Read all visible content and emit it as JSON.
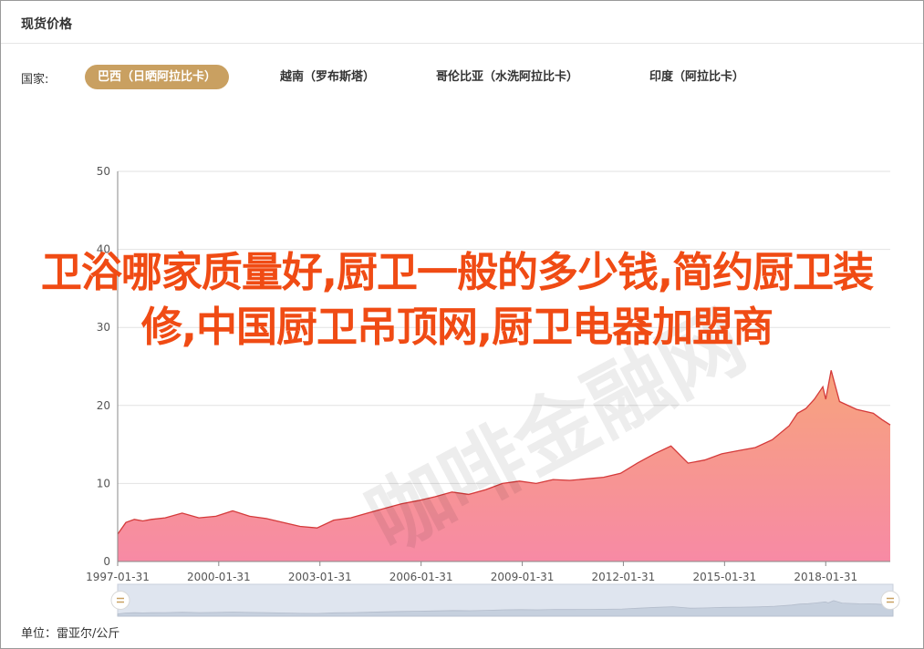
{
  "header": {
    "title": "现货价格"
  },
  "filter": {
    "label": "国家:",
    "countries": [
      {
        "label": "巴西（日晒阿拉比卡）",
        "active": true
      },
      {
        "label": "越南（罗布斯塔）",
        "active": false
      },
      {
        "label": "哥伦比亚（水洗阿拉比卡）",
        "active": false
      },
      {
        "label": "印度（阿拉比卡）",
        "active": false
      }
    ]
  },
  "overlay": {
    "headline": "卫浴哪家质量好,厨卫一般的多少钱,简约厨卫装修,中国厨卫吊顶网,厨卫电器加盟商",
    "watermark": "咖啡金融网"
  },
  "footer": {
    "unit": "单位：雷亚尔/公斤"
  },
  "colors": {
    "accent": "#c9a061",
    "area_top": "#f7a37c",
    "area_bottom": "#f78aa5",
    "line": "#d43a3a",
    "overlay_text": "#f04b14"
  },
  "chart_data": {
    "type": "area",
    "x_ticks": [
      "1997-01-31",
      "2000-01-31",
      "2003-01-31",
      "2006-01-31",
      "2009-01-31",
      "2012-01-31",
      "2015-01-31",
      "2018-01-31"
    ],
    "ylim": [
      0,
      50
    ],
    "y_ticks": [
      0,
      10,
      20,
      30,
      40,
      50
    ],
    "x_range": [
      "1997-01-31",
      "2019-12-31"
    ],
    "grid": true,
    "legend": "none",
    "series": [
      {
        "x": [
          "1997-01-31",
          "1997-04-30",
          "1997-07-31",
          "1997-10-31",
          "1998-01-31",
          "1998-06-30",
          "1998-12-31",
          "1999-06-30",
          "1999-12-31",
          "2000-06-30",
          "2000-12-31",
          "2001-06-30",
          "2001-12-31",
          "2002-06-30",
          "2002-12-31",
          "2003-06-30",
          "2003-12-31",
          "2004-06-30",
          "2004-12-31",
          "2005-06-30",
          "2005-12-31",
          "2006-06-30",
          "2006-12-31",
          "2007-06-30",
          "2007-12-31",
          "2008-06-30",
          "2008-12-31",
          "2009-06-30",
          "2009-12-31",
          "2010-06-30",
          "2010-12-31",
          "2011-06-30",
          "2011-12-31",
          "2012-06-30",
          "2012-12-31",
          "2013-06-30",
          "2013-12-31",
          "2014-06-30",
          "2014-12-31",
          "2015-06-30",
          "2015-12-31",
          "2016-06-30",
          "2016-12-31",
          "2017-03-31",
          "2017-06-30",
          "2017-09-30",
          "2017-12-31",
          "2018-01-31",
          "2018-03-31",
          "2018-06-30",
          "2018-12-31",
          "2019-06-30",
          "2019-09-30",
          "2019-12-31"
        ],
        "values": [
          3.5,
          5.0,
          5.4,
          5.2,
          5.4,
          5.6,
          6.2,
          5.6,
          5.8,
          6.5,
          5.8,
          5.5,
          5.0,
          4.5,
          4.3,
          5.3,
          5.6,
          6.2,
          6.8,
          7.4,
          7.8,
          8.3,
          8.9,
          8.6,
          9.2,
          10.0,
          10.3,
          10.0,
          10.5,
          10.4,
          10.6,
          10.8,
          11.3,
          12.6,
          13.8,
          14.8,
          12.6,
          13.0,
          13.8,
          14.2,
          14.6,
          15.6,
          17.4,
          19.0,
          19.6,
          20.8,
          22.4,
          20.8,
          24.5,
          20.5,
          19.5,
          19.0,
          18.2,
          17.5
        ]
      }
    ]
  }
}
